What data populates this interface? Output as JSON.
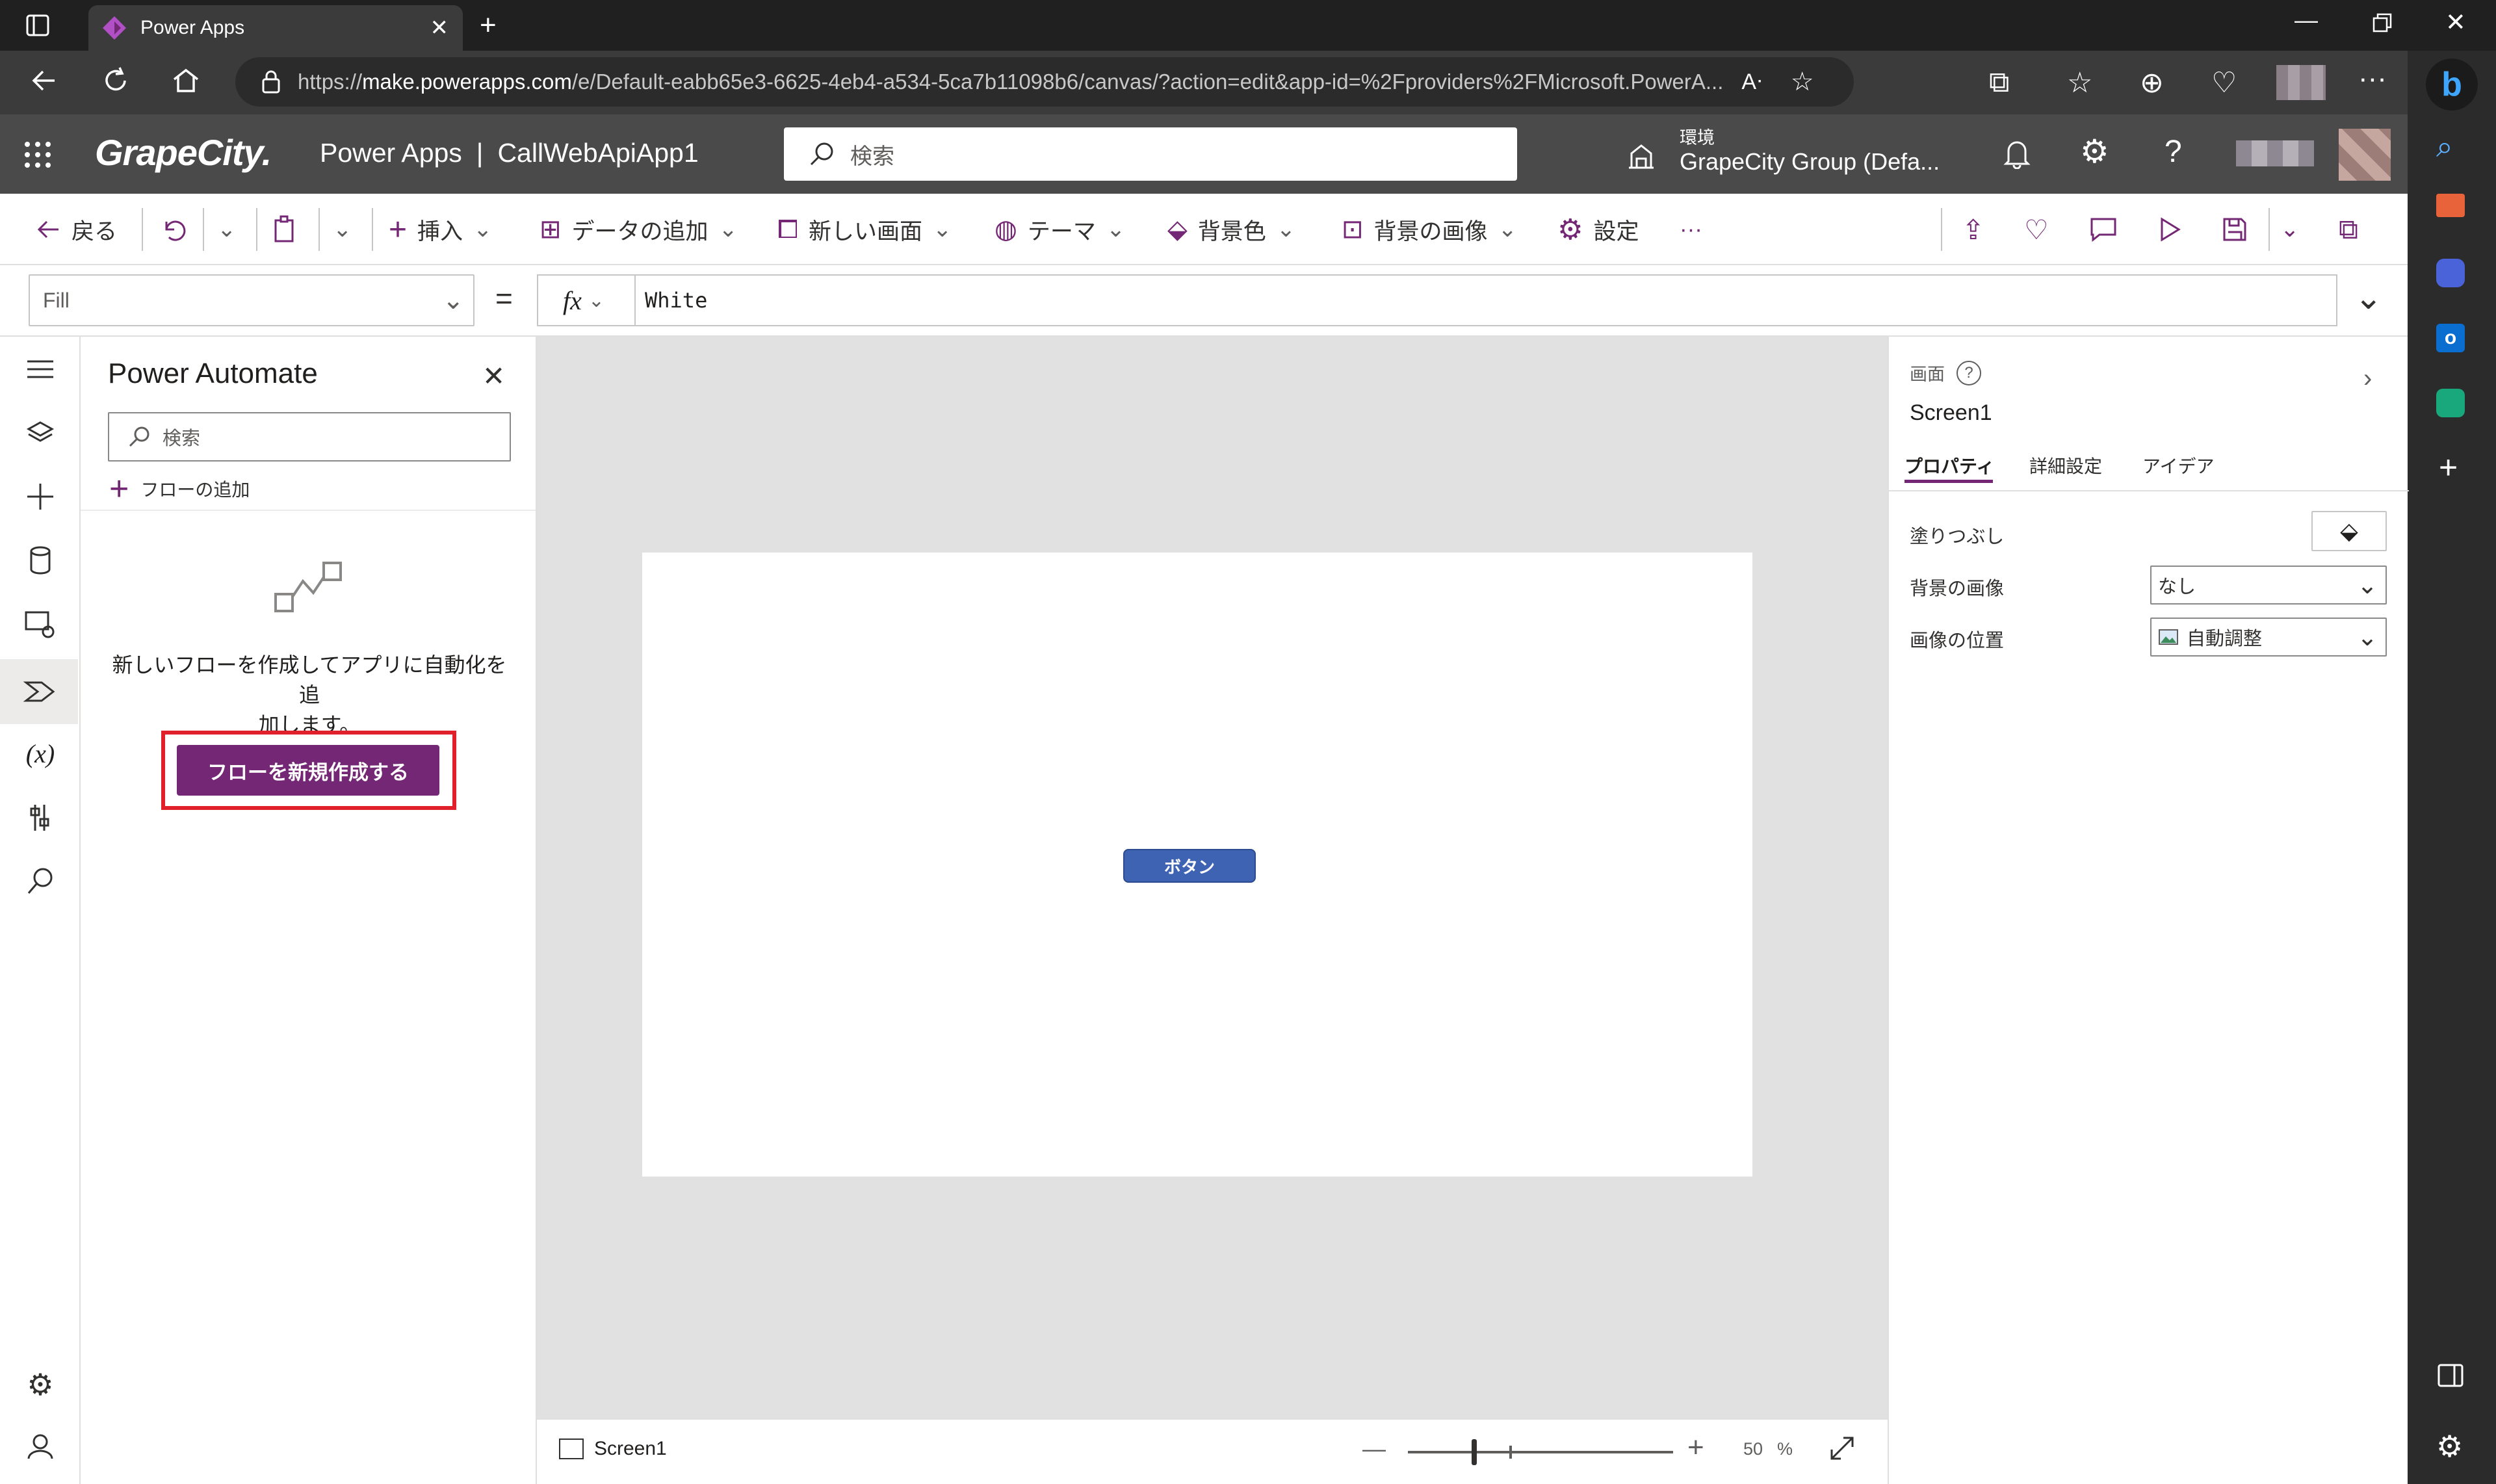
{
  "browser": {
    "tab_title": "Power Apps",
    "url_prefix": "https://",
    "url_host": "make.powerapps.com",
    "url_rest": "/e/Default-eabb65e3-6625-4eb4-a534-5ca7b11098b6/canvas/?action=edit&app-id=%2Fproviders%2FMicrosoft.PowerA..."
  },
  "header": {
    "logo": "GrapeCity.",
    "product": "Power Apps",
    "divider": "|",
    "app_name": "CallWebApiApp1",
    "search_placeholder": "検索",
    "env_label": "環境",
    "env_name": "GrapeCity Group (Defa..."
  },
  "commands": {
    "back": "戻る",
    "insert": "挿入",
    "add_data": "データの追加",
    "new_screen": "新しい画面",
    "theme": "テーマ",
    "bg_color": "背景色",
    "bg_image": "背景の画像",
    "settings": "設定",
    "more": "···"
  },
  "formula": {
    "property": "Fill",
    "equals": "=",
    "fx": "fx",
    "value": "White"
  },
  "automate_panel": {
    "title": "Power Automate",
    "search_placeholder": "検索",
    "add_flow": "フローの追加",
    "empty_text_line1": "新しいフローを作成してアプリに自動化を追",
    "empty_text_line2": "加します。",
    "create_button": "フローを新規作成する"
  },
  "canvas": {
    "button_label": "ボタン",
    "screen_name": "Screen1",
    "zoom_value": "50",
    "zoom_unit": "%"
  },
  "properties": {
    "type_label": "画面",
    "screen_name": "Screen1",
    "tabs": [
      "プロパティ",
      "詳細設定",
      "アイデア"
    ],
    "rows": [
      {
        "label": "塗りつぶし",
        "value": ""
      },
      {
        "label": "背景の画像",
        "value": "なし"
      },
      {
        "label": "画像の位置",
        "value": "自動調整"
      }
    ]
  },
  "colors": {
    "accent_purple": "#742774",
    "highlight_red": "#e0202a",
    "canvas_button": "#3f63b3"
  }
}
